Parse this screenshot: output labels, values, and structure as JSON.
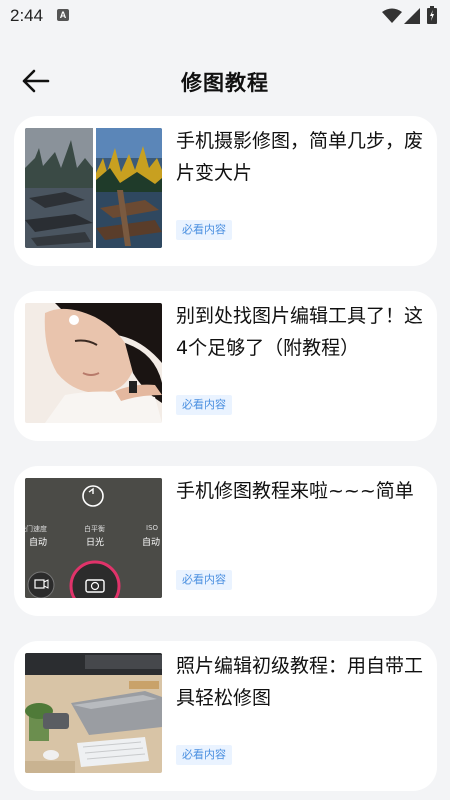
{
  "status_bar": {
    "time": "2:44",
    "notification_icon_letter": "A",
    "icons": [
      "wifi-icon",
      "signal-icon",
      "battery-icon"
    ]
  },
  "header": {
    "title": "修图教程",
    "back_icon": "back-arrow-icon"
  },
  "articles": [
    {
      "title": "手机摄影修图，简单几步，废片变大片",
      "badge": "必看内容",
      "thumbnail": "landscape-before-after-image"
    },
    {
      "title": "别到处找图片编辑工具了！这4个足够了（附教程）",
      "badge": "必看内容",
      "thumbnail": "girl-with-earbud-image"
    },
    {
      "title": "手机修图教程来啦~~~简单",
      "badge": "必看内容",
      "thumbnail": "camera-app-screenshot-image",
      "thumbnail_text": {
        "shutter_label": "快门速度",
        "shutter_value": "自动",
        "wb_label": "白平衡",
        "wb_value": "日光",
        "iso_label": "ISO",
        "iso_value": "自动"
      }
    },
    {
      "title": "照片编辑初级教程：用自带工具轻松修图",
      "badge": "必看内容",
      "thumbnail": "desk-laptop-image"
    }
  ],
  "colors": {
    "background": "#f3f4f6",
    "card": "#ffffff",
    "badge_bg": "#eaf3ff",
    "badge_text": "#4a8fe0"
  }
}
